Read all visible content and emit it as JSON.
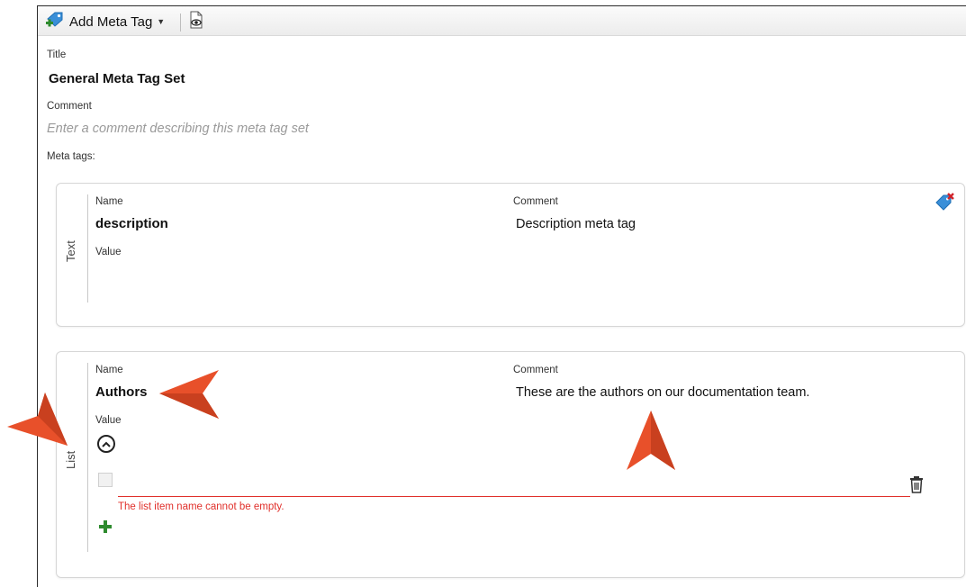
{
  "toolbar": {
    "add_meta_tag_label": "Add Meta Tag"
  },
  "form": {
    "title_label": "Title",
    "title_value": "General Meta Tag Set",
    "comment_label": "Comment",
    "comment_placeholder": "Enter a comment describing this meta tag set",
    "meta_tags_label": "Meta tags:"
  },
  "meta_tags": [
    {
      "type": "Text",
      "name_label": "Name",
      "name": "description",
      "comment_label": "Comment",
      "comment": "Description meta tag",
      "value_label": "Value"
    },
    {
      "type": "List",
      "name_label": "Name",
      "name": "Authors",
      "comment_label": "Comment",
      "comment": "These are the authors on our documentation team.",
      "value_label": "Value",
      "list_item_value": "",
      "error": "The list item name cannot be empty."
    }
  ],
  "colors": {
    "pointer": "#e8502a",
    "error": "#e0302b",
    "add_green": "#2e8b2e",
    "tag_blue": "#3a8fd8"
  }
}
